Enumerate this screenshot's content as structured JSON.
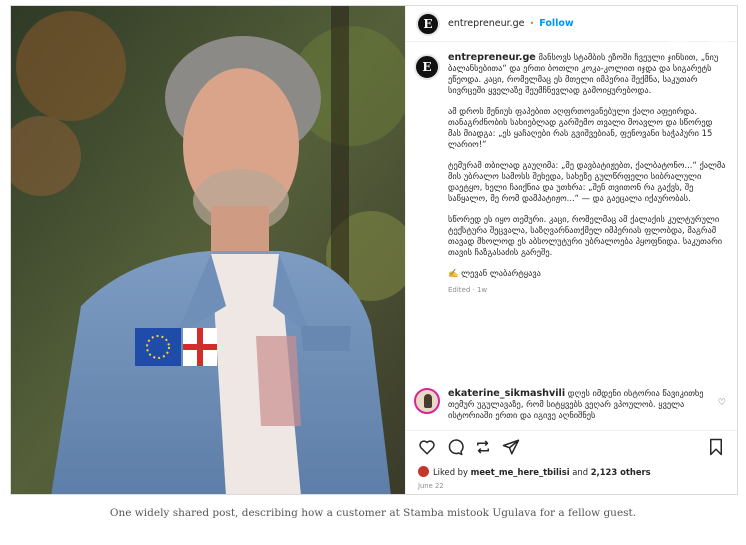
{
  "post": {
    "username": "entrepreneur.ge",
    "avatar_letter": "E",
    "follow_label": "Follow",
    "separator": "•",
    "caption_paragraphs": [
      "მანსოვს სტამბის ეზოში ჩვეული ჯინსით, „ნიუ ბალანსებითა“ და ერთი ბოთლი კოკა-კოლით იჯდა და სიგარეტს ეწეოდა. კაცი, რომელმაც ეს მთელი იმპერია შექმნა, საკუთარ სივრცეში ყველაზე შეუმჩნევლად გამოიყურებოდა.",
      "ამ დროს მენიუს ფაპებით აღფრთოვანებული ქალი აფეირდა. თანაგრძნობის სახიებლად გარშემო თვალი მოავლო და სწორედ მას მიადგა: „ეს ყაჩაღები რას გვიშვებიან, ფენოვანი ხაჭაპური 15 ლარიო!“",
      "ტემურამ თბილად გაუღიმა: „მე დავბატიჟებთ, ქალბატონო...“ ქალმა მის უბრალო სამოსს შეხედა, სახეზე გულწრფელი სიბრალული დაეტყო, ხელი ჩაიქნია და უთხრა: „შენ თვითონ რა გაქვს, შე საწყალო, მე რომ დამპატიჟო...“ — და გაეცალა იქაურობას.",
      "სწორედ ეს იყო თემური. კაცი, რომელმაც ამ ქალაქის კულტურული ტექსტურა შეცვალა, საზღვარნათქმელ იმპერიას ფლობდა, მაგრამ თავად მხოლოდ ეს აბსოლუტური უბრალოება პყოფნიდა. საკუთარი თავის ჩაზგასაძის გარეშე.",
      "✍️ ლევან ლაბარტყავა"
    ],
    "edited_label": "Edited · 1w"
  },
  "comment": {
    "username": "ekaterine_sikmashvili",
    "text": "დღეს იმდენი ისტორია წავიკითხე თემურ უგულავაზე, რომ სიტყვებს ვეღარ ვპოულობ. ყველა ისტორიაში ერთი და იგივე აღნიშნეს"
  },
  "engagement": {
    "liked_by_prefix": "Liked by",
    "liked_by_user": "meet_me_here_tbilisi",
    "and_label": "and",
    "others_label": "2,123 others",
    "date": "June 22"
  },
  "figure_caption": "One widely shared post, describing how a customer at Stamba mistook Ugulava for a fellow guest.",
  "icons": [
    "heart-icon",
    "comment-icon",
    "repost-icon",
    "share-icon",
    "bookmark-icon",
    "more-icon"
  ],
  "colors": {
    "follow": "#0095f6",
    "text": "#262626",
    "muted": "#8e8e8e"
  }
}
